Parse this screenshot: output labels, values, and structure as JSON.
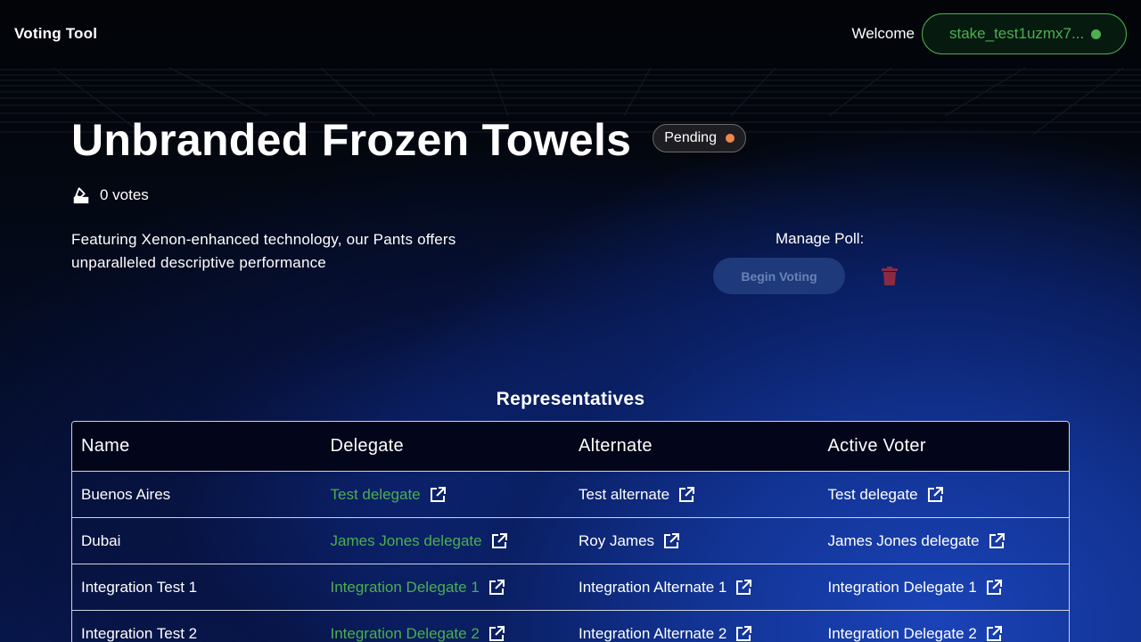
{
  "header": {
    "app_title": "Voting Tool",
    "welcome_label": "Welcome",
    "wallet_address": "stake_test1uzmx7...",
    "wallet_status_color": "#4caf50"
  },
  "poll": {
    "title": "Unbranded Frozen Towels",
    "status": "Pending",
    "status_color": "#f0874a",
    "votes": "0 votes",
    "description": "Featuring Xenon-enhanced technology, our Pants offers unparalleled descriptive performance"
  },
  "manage": {
    "label": "Manage Poll:",
    "begin_voting_label": "Begin Voting"
  },
  "representatives": {
    "title": "Representatives",
    "columns": [
      "Name",
      "Delegate",
      "Alternate",
      "Active Voter"
    ],
    "rows": [
      {
        "name": "Buenos Aires",
        "delegate": "Test delegate",
        "alternate": "Test alternate",
        "active_voter": "Test delegate"
      },
      {
        "name": "Dubai",
        "delegate": "James Jones delegate",
        "alternate": "Roy James",
        "active_voter": "James Jones delegate"
      },
      {
        "name": "Integration Test 1",
        "delegate": "Integration Delegate 1",
        "alternate": "Integration Alternate 1",
        "active_voter": "Integration Delegate 1"
      },
      {
        "name": "Integration Test 2",
        "delegate": "Integration Delegate 2",
        "alternate": "Integration Alternate 2",
        "active_voter": "Integration Delegate 2"
      }
    ]
  },
  "icons": {
    "vote": "ballot-box-icon",
    "external_link": "external-link-icon",
    "delete": "trash-icon"
  }
}
